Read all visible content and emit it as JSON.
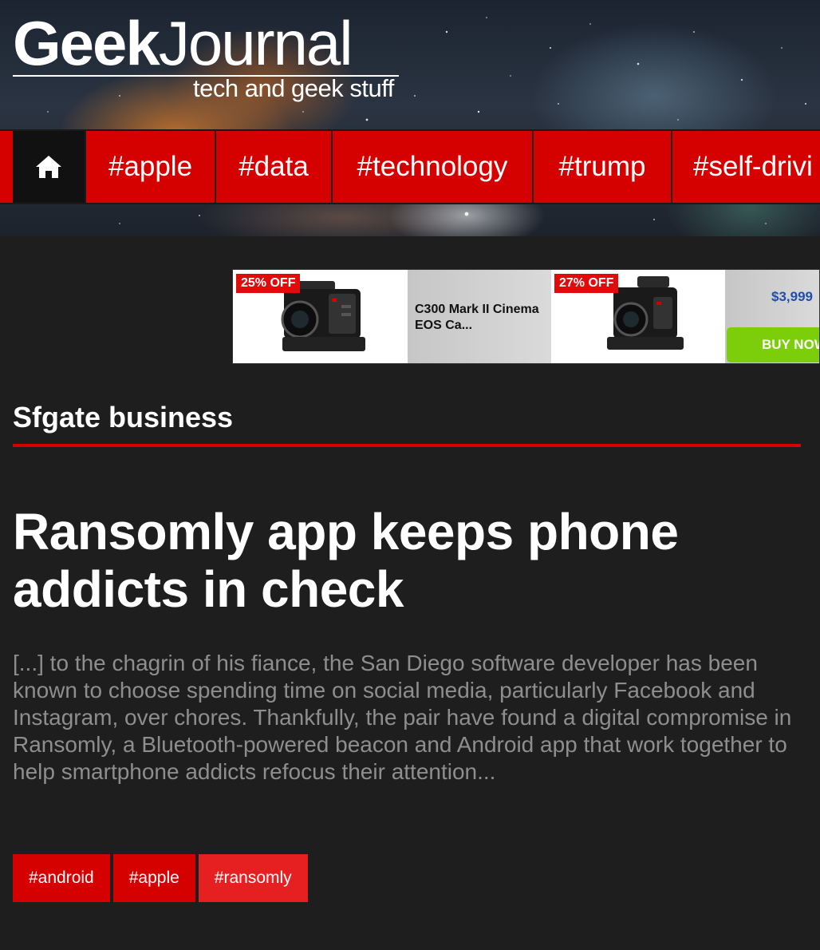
{
  "site": {
    "logo_geek": "Geek",
    "logo_journal": "Journal",
    "tagline": "tech and geek stuff"
  },
  "nav": {
    "home_icon": "home-icon",
    "items": [
      {
        "label": "#apple"
      },
      {
        "label": "#data"
      },
      {
        "label": "#technology"
      },
      {
        "label": "#trump"
      },
      {
        "label": "#self-drivi"
      }
    ]
  },
  "ad": {
    "products": [
      {
        "badge": "25% OFF",
        "title": "C300 Mark II Cinema EOS Ca..."
      },
      {
        "badge": "27% OFF",
        "price": "$3,999",
        "button": "BUY NOW"
      }
    ]
  },
  "section": {
    "title": "Sfgate business"
  },
  "article": {
    "headline": "Ransomly app keeps phone addicts in check",
    "excerpt": "[...] to the chagrin of his fiance, the San Diego software developer has been known to choose spending time on social media, particularly Facebook and Instagram, over chores. Thankfully, the pair have found a digital compromise in Ransomly, a Bluetooth-powered beacon and Android app that work together to help smartphone addicts refocus their attention...",
    "tags": [
      {
        "label": "#android"
      },
      {
        "label": "#apple"
      },
      {
        "label": "#ransomly"
      }
    ]
  },
  "colors": {
    "accent": "#d50000",
    "background": "#1e1e1e",
    "buy_button": "#7ccd0a",
    "price": "#1d4fb0"
  }
}
